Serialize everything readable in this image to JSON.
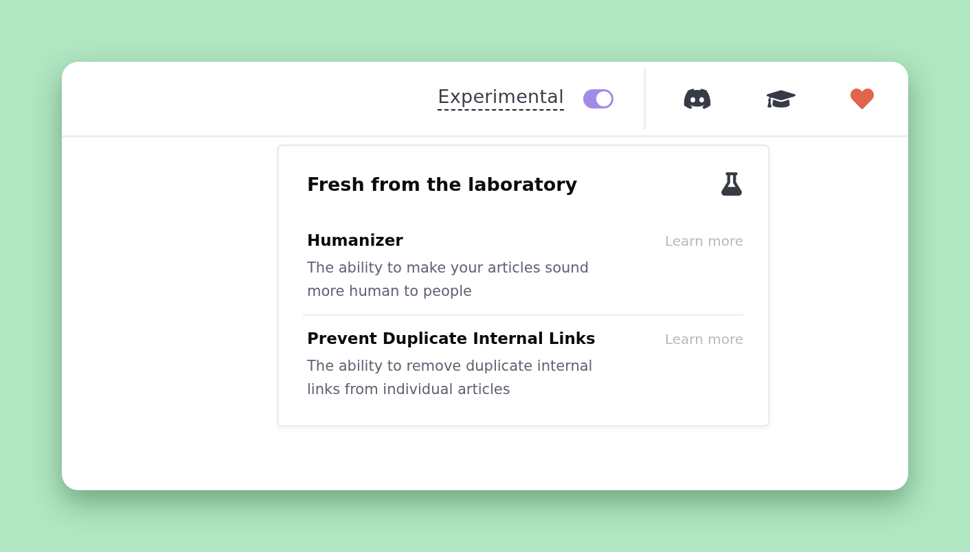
{
  "header": {
    "experimental": {
      "label": "Experimental",
      "on": true
    }
  },
  "experiments_panel": {
    "title": "Fresh from the laboratory",
    "items": [
      {
        "name": "Humanizer",
        "description": "The ability to make your articles sound more human to people",
        "link": "Learn more"
      },
      {
        "name": "Prevent Duplicate Internal Links",
        "description": "The ability to remove duplicate internal links from individual articles",
        "link": "Learn more"
      }
    ]
  }
}
